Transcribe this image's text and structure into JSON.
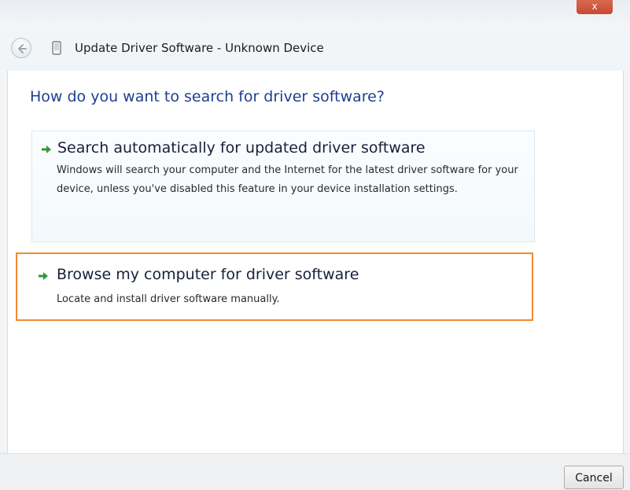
{
  "window": {
    "close_glyph": "x",
    "title": "Update Driver Software - Unknown Device",
    "back_icon": "back-arrow-icon",
    "device_icon": "device-icon"
  },
  "main": {
    "heading": "How do you want to search for driver software?",
    "options": [
      {
        "title": "Search automatically for updated driver software",
        "description": "Windows will search your computer and the Internet for the latest driver software for your device, unless you've disabled this feature in your device installation settings.",
        "icon": "green-arrow-icon"
      },
      {
        "title": "Browse my computer for driver software",
        "description": "Locate and install driver software manually.",
        "icon": "green-arrow-icon"
      }
    ]
  },
  "footer": {
    "cancel_label": "Cancel"
  },
  "colors": {
    "heading": "#1e3f8f",
    "highlight_border": "#f08a2e",
    "arrow": "#2f9a3a",
    "close_button": "#c94f37"
  }
}
